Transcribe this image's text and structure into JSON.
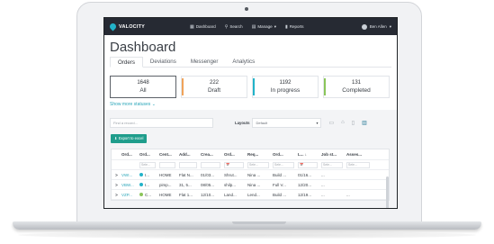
{
  "app": {
    "logo_text": "VALOCITY"
  },
  "navbar": {
    "items": [
      {
        "label": "Dashboard",
        "icon": "dashboard-icon",
        "glyph": "▦"
      },
      {
        "label": "Search",
        "icon": "search-icon",
        "glyph": "⚲"
      },
      {
        "label": "Manage",
        "icon": "manage-icon",
        "glyph": "▤",
        "caret": "▾"
      },
      {
        "label": "Reports",
        "icon": "reports-icon",
        "glyph": "▮"
      }
    ],
    "user_name": "Ben Allen",
    "user_caret": "▾"
  },
  "page_title": "Dashboard",
  "tabs": [
    "Orders",
    "Deviations",
    "Messenger",
    "Analytics"
  ],
  "statuses": [
    {
      "count": "1648",
      "label": "All",
      "color": ""
    },
    {
      "count": "222",
      "label": "Draft",
      "color": "#f0a35a"
    },
    {
      "count": "1192",
      "label": "In progress",
      "color": "#22b3c9"
    },
    {
      "count": "131",
      "label": "Completed",
      "color": "#8bc55a"
    }
  ],
  "show_more": "Show more statuses",
  "show_more_caret": "⌄",
  "toolbar": {
    "search_placeholder": "Find a record...",
    "layouts_label": "Layouts",
    "layout_value": "Default",
    "layout_caret": "▾"
  },
  "export_button": "Export to excel",
  "export_icon": "⬇",
  "grid": {
    "columns": [
      "Ord...",
      "Ord...",
      "Cent...",
      "Add...",
      "Crea...",
      "Ord...",
      "Req...",
      "Ord...",
      "L... ↓",
      "Job st...",
      "Asses..."
    ],
    "filters": [
      "",
      "Sele...",
      "",
      "",
      "",
      "📅",
      "Sele...",
      "Sele...",
      "📅",
      "Sele...",
      "Sele..."
    ],
    "rows": [
      {
        "expand": ">",
        "cells": [
          "VWI...",
          "I...",
          "HOME",
          "Flat N...",
          "01/03...",
          "Shrut...",
          "Nina ...",
          "Build ...",
          "01/16...",
          "...",
          ""
        ],
        "status_color": "#22b3c9"
      },
      {
        "expand": ">",
        "cells": [
          "VBW...",
          "I...",
          "pimp...",
          "31, 5...",
          "08/05...",
          "shilp...",
          "Nina ...",
          "Full V...",
          "12/20...",
          "...",
          ""
        ],
        "status_color": "#22b3c9"
      },
      {
        "expand": ">",
        "cells": [
          "VZP...",
          "C...",
          "HOME",
          "Flat 1...",
          "12/10...",
          "Land...",
          "Lend...",
          "Build ...",
          "12/19...",
          "...",
          "..."
        ],
        "status_color": "#8bc55a"
      }
    ]
  }
}
